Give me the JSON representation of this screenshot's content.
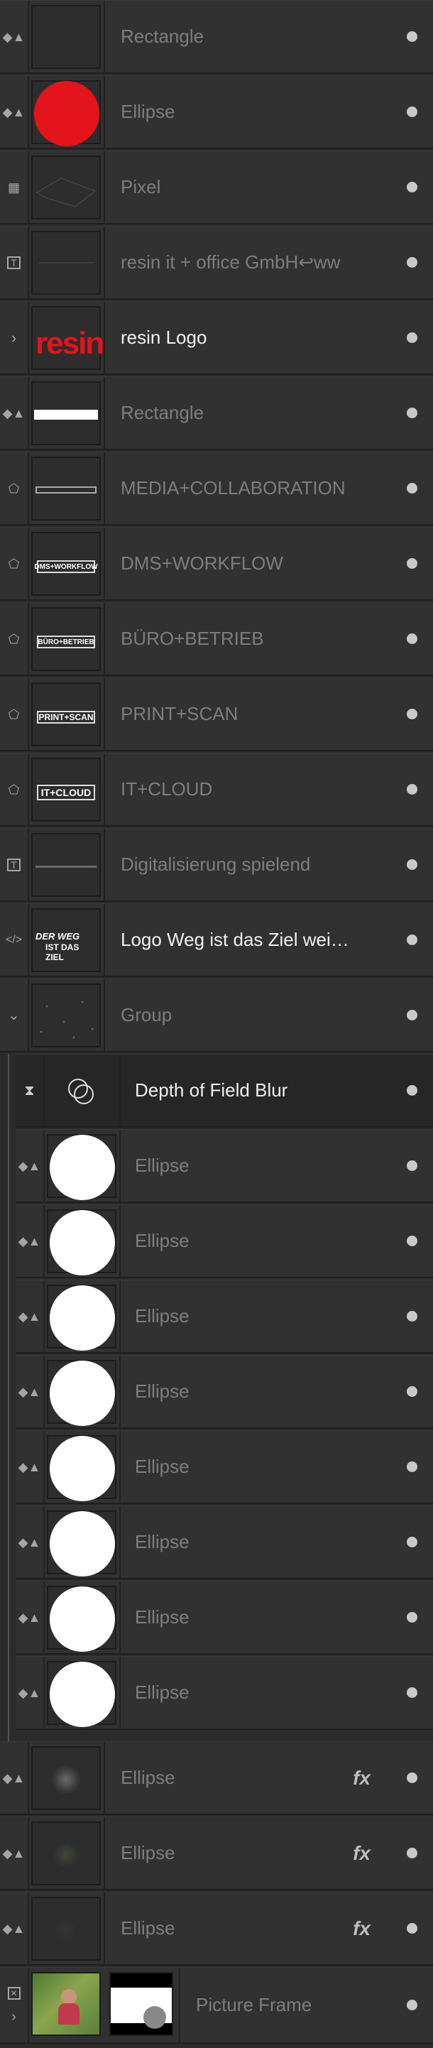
{
  "layers": [
    {
      "label": "Rectangle",
      "icon": "shape-icon"
    },
    {
      "label": "Ellipse",
      "icon": "shape-icon"
    },
    {
      "label": "Pixel",
      "icon": "pixel-icon"
    },
    {
      "label": "resin it + office GmbH↩ww",
      "icon": "text-frame-icon"
    },
    {
      "label": "resin Logo",
      "icon": "chevron-right-icon",
      "thumb_text": "resin"
    },
    {
      "label": "Rectangle",
      "icon": "shape-icon"
    },
    {
      "label": "MEDIA+COLLABORATION",
      "icon": "symbol-icon"
    },
    {
      "label": "DMS+WORKFLOW",
      "icon": "symbol-icon",
      "thumb_text": "DMS+WORKFLOW"
    },
    {
      "label": "BÜRO+BETRIEB",
      "icon": "symbol-icon",
      "thumb_text": "BÜRO+BETRIEB"
    },
    {
      "label": "PRINT+SCAN",
      "icon": "symbol-icon",
      "thumb_text": "PRINT+SCAN"
    },
    {
      "label": "IT+CLOUD",
      "icon": "symbol-icon",
      "thumb_text": "IT+CLOUD"
    },
    {
      "label": "Digitalisierung spielend",
      "icon": "text-frame-icon"
    },
    {
      "label": "Logo Weg ist das Ziel wei…",
      "icon": "code-icon",
      "thumb_text_1": "DER WEG",
      "thumb_text_2": "IST DAS ZIEL"
    },
    {
      "label": "Group",
      "icon": "chevron-down-icon"
    },
    {
      "label": "Depth of Field Blur",
      "icon": "hourglass-icon"
    },
    {
      "label": "Ellipse",
      "icon": "shape-icon"
    },
    {
      "label": "Ellipse",
      "icon": "shape-icon"
    },
    {
      "label": "Ellipse",
      "icon": "shape-icon"
    },
    {
      "label": "Ellipse",
      "icon": "shape-icon"
    },
    {
      "label": "Ellipse",
      "icon": "shape-icon"
    },
    {
      "label": "Ellipse",
      "icon": "shape-icon"
    },
    {
      "label": "Ellipse",
      "icon": "shape-icon"
    },
    {
      "label": "Ellipse",
      "icon": "shape-icon"
    },
    {
      "label": "Ellipse",
      "icon": "shape-icon",
      "fx": "fx"
    },
    {
      "label": "Ellipse",
      "icon": "shape-icon",
      "fx": "fx"
    },
    {
      "label": "Ellipse",
      "icon": "shape-icon",
      "fx": "fx"
    },
    {
      "label": "Picture Frame",
      "icon": "picture-frame-icon"
    }
  ],
  "colors": {
    "panel_bg": "#2b2b2b",
    "row_bg": "#313131",
    "accent_red": "#e3141b",
    "text_dim": "#7d7d7d",
    "text_bright": "#f0f0f0"
  }
}
